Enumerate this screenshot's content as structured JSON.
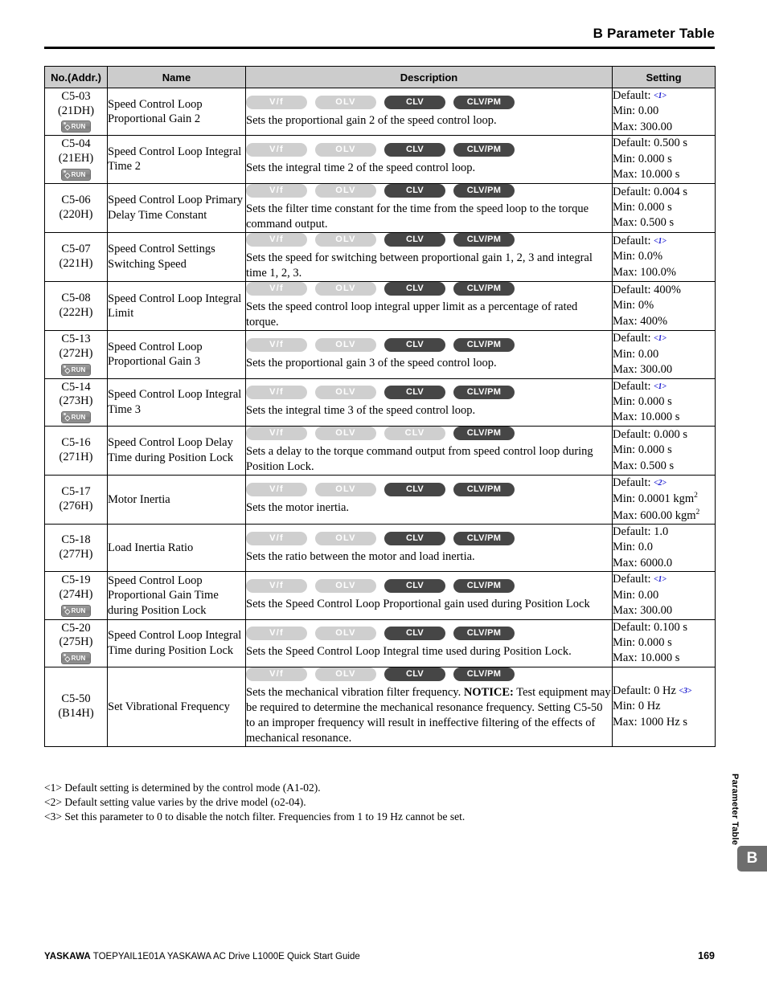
{
  "header": {
    "title": "B  Parameter Table"
  },
  "table": {
    "columns": [
      "No.(Addr.)",
      "Name",
      "Description",
      "Setting"
    ],
    "mode_labels": [
      "V/f",
      "OLV",
      "CLV",
      "CLV/PM"
    ],
    "run_badge_label": "RUN",
    "rows": [
      {
        "no": "C5-03",
        "addr": "(21DH)",
        "run": true,
        "name": "Speed Control Loop Proportional Gain 2",
        "modes": [
          false,
          false,
          true,
          true
        ],
        "description": "Sets the proportional gain 2 of the speed control loop.",
        "notice": "",
        "setting": [
          "Default: <1>",
          "Min: 0.00",
          "Max: 300.00"
        ],
        "footnote_on_default": "1"
      },
      {
        "no": "C5-04",
        "addr": "(21EH)",
        "run": true,
        "name": "Speed Control Loop Integral Time 2",
        "modes": [
          false,
          false,
          true,
          true
        ],
        "description": "Sets the integral time 2 of the speed control loop.",
        "notice": "",
        "setting": [
          "Default: 0.500 s",
          "Min: 0.000 s",
          "Max: 10.000 s"
        ],
        "footnote_on_default": ""
      },
      {
        "no": "C5-06",
        "addr": "(220H)",
        "run": false,
        "name": "Speed Control Loop Primary Delay Time Constant",
        "modes": [
          false,
          false,
          true,
          true
        ],
        "description": "Sets the filter time constant for the time from the speed loop to the torque command output.",
        "notice": "",
        "setting": [
          "Default: 0.004 s",
          "Min: 0.000 s",
          "Max: 0.500 s"
        ],
        "footnote_on_default": ""
      },
      {
        "no": "C5-07",
        "addr": "(221H)",
        "run": false,
        "name": "Speed Control Settings Switching Speed",
        "modes": [
          false,
          false,
          true,
          true
        ],
        "description": "Sets the speed for switching between proportional gain 1, 2, 3 and integral time 1, 2, 3.",
        "notice": "",
        "setting": [
          "Default: <1>",
          "Min: 0.0%",
          "Max: 100.0%"
        ],
        "footnote_on_default": "1"
      },
      {
        "no": "C5-08",
        "addr": "(222H)",
        "run": false,
        "name": "Speed Control Loop Integral Limit",
        "modes": [
          false,
          false,
          true,
          true
        ],
        "description": "Sets the speed control loop integral upper limit as a percentage of rated torque.",
        "notice": "",
        "setting": [
          "Default: 400%",
          "Min: 0%",
          "Max: 400%"
        ],
        "footnote_on_default": ""
      },
      {
        "no": "C5-13",
        "addr": "(272H)",
        "run": true,
        "name": "Speed Control Loop Proportional Gain 3",
        "modes": [
          false,
          false,
          true,
          true
        ],
        "description": "Sets the proportional gain 3 of the speed control loop.",
        "notice": "",
        "setting": [
          "Default: <1>",
          "Min: 0.00",
          "Max: 300.00"
        ],
        "footnote_on_default": "1"
      },
      {
        "no": "C5-14",
        "addr": "(273H)",
        "run": true,
        "name": "Speed Control Loop Integral Time 3",
        "modes": [
          false,
          false,
          true,
          true
        ],
        "description": "Sets the integral time 3 of the speed control loop.",
        "notice": "",
        "setting": [
          "Default: <1>",
          "Min: 0.000 s",
          "Max: 10.000 s"
        ],
        "footnote_on_default": "1"
      },
      {
        "no": "C5-16",
        "addr": "(271H)",
        "run": false,
        "name": "Speed Control Loop Delay Time during Position Lock",
        "modes": [
          false,
          false,
          false,
          true
        ],
        "description": "Sets a delay to the torque command output from speed control loop during Position Lock.",
        "notice": "",
        "setting": [
          "Default: 0.000 s",
          "Min: 0.000 s",
          "Max: 0.500 s"
        ],
        "footnote_on_default": ""
      },
      {
        "no": "C5-17",
        "addr": "(276H)",
        "run": false,
        "name": "Motor Inertia",
        "modes": [
          false,
          false,
          true,
          true
        ],
        "description": "Sets the motor inertia.",
        "notice": "",
        "setting": [
          "Default: <2>",
          "Min: 0.0001 kgm2",
          "Max: 600.00 kgm2"
        ],
        "footnote_on_default": "2"
      },
      {
        "no": "C5-18",
        "addr": "(277H)",
        "run": false,
        "name": "Load Inertia Ratio",
        "modes": [
          false,
          false,
          true,
          true
        ],
        "description": "Sets the ratio between the motor and load inertia.",
        "notice": "",
        "setting": [
          "Default: 1.0",
          "Min: 0.0",
          "Max: 6000.0"
        ],
        "footnote_on_default": ""
      },
      {
        "no": "C5-19",
        "addr": "(274H)",
        "run": true,
        "name": "Speed Control Loop Proportional Gain Time during Position Lock",
        "modes": [
          false,
          false,
          true,
          true
        ],
        "description": "Sets the Speed Control Loop Proportional gain used during Position Lock",
        "notice": "",
        "setting": [
          "Default: <1>",
          "Min: 0.00",
          "Max: 300.00"
        ],
        "footnote_on_default": "1"
      },
      {
        "no": "C5-20",
        "addr": "(275H)",
        "run": true,
        "name": "Speed Control Loop Integral Time during Position Lock",
        "modes": [
          false,
          false,
          true,
          true
        ],
        "description": "Sets the Speed Control Loop Integral time used during Position Lock.",
        "notice": "",
        "setting": [
          "Default: 0.100 s",
          "Min: 0.000 s",
          "Max: 10.000 s"
        ],
        "footnote_on_default": ""
      },
      {
        "no": "C5-50",
        "addr": "(B14H)",
        "run": false,
        "name": "Set Vibrational Frequency",
        "modes": [
          false,
          false,
          true,
          true
        ],
        "description": "Sets the mechanical vibration filter frequency.",
        "notice_label": "NOTICE:",
        "notice": " Test equipment may be required to determine the mechanical resonance frequency. Setting C5-50 to an improper frequency will result in ineffective filtering of the effects of mechanical resonance.",
        "setting": [
          "Default: 0 Hz <3>",
          "Min: 0 Hz",
          "Max: 1000 Hz s"
        ],
        "footnote_on_default": "3"
      }
    ]
  },
  "footnotes": [
    "<1> Default setting is determined by the control mode (A1-02).",
    "<2> Default setting value varies by the drive model (o2-04).",
    "<3> Set this parameter to 0 to disable the notch filter. Frequencies from 1 to 19 Hz cannot be set."
  ],
  "side_tab": {
    "label": "Parameter Table",
    "letter": "B"
  },
  "footer": {
    "brand": "YASKAWA",
    "text": " TOEPYAIL1E01A YASKAWA AC Drive L1000E Quick Start Guide",
    "page_number": "169"
  },
  "colors": {
    "header_fill": "#cccccc",
    "mode_on": "#464646",
    "mode_off": "#cfcfcf",
    "footnote_ref": "#1a1ad0",
    "side_tab": "#6e6e6e"
  }
}
